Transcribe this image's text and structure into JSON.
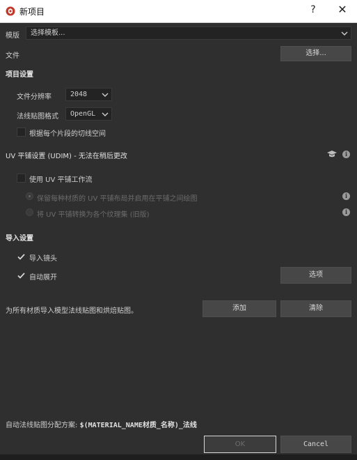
{
  "window": {
    "title": "新项目",
    "help": "?",
    "close": "✕"
  },
  "template": {
    "label": "模版",
    "value": "选择模板..."
  },
  "file": {
    "label": "文件",
    "button": "选择..."
  },
  "project_settings": {
    "heading": "项目设置",
    "resolution_label": "文件分辨率",
    "resolution_value": "2048",
    "normal_format_label": "法线贴图格式",
    "normal_format_value": "OpenGL",
    "tangent_label": "根据每个片段的切线空间"
  },
  "uv": {
    "heading": "UV 平铺设置 (UDIM) - 无法在稍后更改",
    "use_label": "使用 UV 平铺工作流",
    "option1": "保留每种材质的 UV 平铺布局并启用在平铺之间绘图",
    "option2": "将 UV 平铺转换为各个纹理集 (旧版)"
  },
  "import": {
    "heading": "导入设置",
    "cameras_label": "导入镜头",
    "unwrap_label": "自动展开",
    "options_button": "选项"
  },
  "bake": {
    "text": "为所有材质导入模型法线贴图和烘焙贴图。",
    "add_button": "添加",
    "clear_button": "清除"
  },
  "footer": {
    "scheme_label": "自动法线贴图分配方案:",
    "scheme_value": "$(MATERIAL_NAME材质_名称)_法线",
    "ok": "OK",
    "cancel": "Cancel"
  },
  "colors": {
    "background": "#2f2f2f",
    "button": "#474747",
    "field": "#232323"
  }
}
